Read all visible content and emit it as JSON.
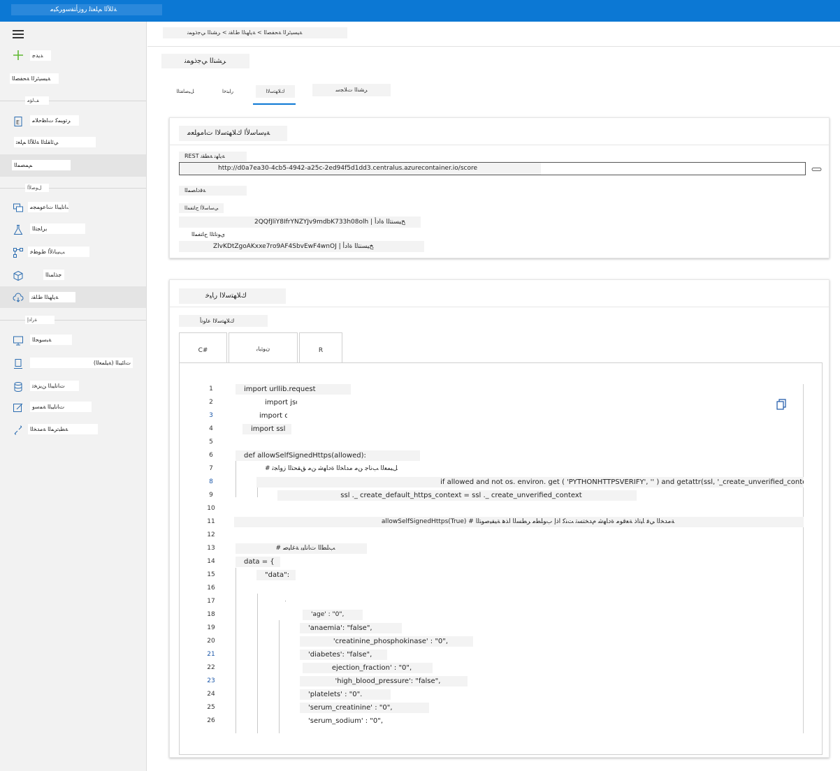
{
  "topbar": {
    "title": "ﺔﻟﻶﻟا ﻢﻠﻌﺘﻟ روزﺄﺘﻔﺳوﺮﻜﻴﻣ"
  },
  "sidebar": {
    "new_label": "ﺪﻳﺪﺟ",
    "home_label": "ﺔﻴﺴﻴﺋﺮﻟا ﺔﺤﻔﺼﻟا",
    "section_author": "ﻒﻟﺆﻣ",
    "items_author": [
      {
        "label": "ﺮﺗﻮﺒﻤﻛ تﺎﻈﺣﻼﻣ",
        "icon": "notebook-icon"
      },
      {
        "label": "ﻲﺋﺎﻘﻠﺘﻟا ﺔﻟﻶﻟا ﻢﻠﻌﺗ",
        "icon": "automl-icon"
      },
      {
        "label": "ﻢﻤﺼﻤﻟا",
        "icon": "designer-icon"
      }
    ],
    "section_assets": "لﻮﺻﻷا",
    "items_assets": [
      {
        "label": "تﺎﻧﺎﻴﺒﻟا تﺎﻋﻮﻤﺠﻣ",
        "icon": "datasets-icon"
      },
      {
        "label": "برﺎﺠﺘﻟا",
        "icon": "experiments-icon"
      },
      {
        "label": "ﺐﻴﺑﺎﻧﻷا طﻮﻄﺧ",
        "icon": "pipelines-icon"
      },
      {
        "label": "جذﺎﻤﻨﻟا",
        "icon": "models-icon"
      },
      {
        "label": "ﺔﻳﺎﻬﻨﻟا طﺎﻘﻧ",
        "icon": "endpoints-icon"
      }
    ],
    "section_manage": "ةرادإ",
    "items_manage": [
      {
        "label": "ﺔﺒﺳﻮﺤﻟا",
        "icon": "compute-icon"
      },
      {
        "label": "(ﺔﻴﻠﻤﻌﻟا) تﺎﺌﻴﺒﻟا",
        "icon": "environments-icon"
      },
      {
        "label": "تﺎﻧﺎﻴﺒﻟا ﻦﻳﺰﺨﺗ",
        "icon": "datastores-icon"
      },
      {
        "label": "تﺎﻧﺎﻴﺒﻟا ﺔﻤﺳو",
        "icon": "labeling-icon"
      },
      {
        "label": "ﺔﻄﺒﺗﺮﻤﻟا ﺔﻣﺪﺨﻟا",
        "icon": "linked-services-icon"
      }
    ]
  },
  "breadcrumb": "ﺔﻴﺴﻴﺋﺮﻟا ﺔﺤﻔﺼﻟا > ﺔﻳﺎﻬﻨﻟا طﺎﻘﻧ > ﺮﺸﻨﻟا ﻲﺟذﻮﻤﻧ",
  "page_title": "ﺮﺸﻨﻟا ﻲﺟذﻮﻤﻧ",
  "tabs": [
    {
      "label": "ﻞﻴﺻﺎﻔﺘﻟا"
    },
    {
      "label": "رﺎﺒﺘﺧا"
    },
    {
      "label": "كﻼﻬﺘﺳﻻا"
    },
    {
      "label": "ﺮﺸﻨﻟا تﻼﺠﺳ"
    }
  ],
  "basic_info": {
    "title": "ﺔﻴﺳﺎﺳﻷا كﻼﻬﺘﺳﻻا تﺎﻣﻮﻠﻌﻣ",
    "rest_label": "REST ﺔﻳﺎﻬﻧ ﺔﻄﻘﻧ",
    "url": "http://d0a7ea30-4cb5-4942-a25c-2ed94f5d1dd3.centralus.azurecontainer.io/score",
    "auth_label": "ﺔﻗدﺎﺼﻤﻟا",
    "primary_key_label": "ﻲﺳﺎﺳﻷا حﺎﺘﻔﻤﻟا",
    "primary_key": "2QQfJliY8IfrYNZYJv9mdbK733h08olh | ﺦﻴﺴﻨﺘﻟا ةادأ",
    "secondary_key_label": "يﻮﻧﺎﺜﻟا حﺎﺘﻔﻤﻟا",
    "secondary_key": "ZlvKDtZgoAKxxe7ro9AF4SbvEwF4wnOJ | ﺦﻴﺴﻨﺘﻟا ةادأ"
  },
  "consume_options": {
    "title": "كﻼﻬﺘﺳﻻا رﺎﻴﺧ",
    "type_label": "كﻼﻬﺘﺳﻻا عاﻮﻧأ",
    "languages": [
      {
        "label": "C#"
      },
      {
        "label": "نﻮﺜﻳﺎﺑ"
      },
      {
        "label": "R"
      }
    ]
  },
  "code_lines": [
    {
      "n": "1",
      "text": "import urllib.request"
    },
    {
      "n": "2",
      "text": "import json"
    },
    {
      "n": "3",
      "text": "import os"
    },
    {
      "n": "4",
      "text": "import ssl"
    },
    {
      "n": "5",
      "text": ""
    },
    {
      "n": "6",
      "text": "def allowSelfSignedHttps(allowed):"
    },
    {
      "n": "7",
      "text": "# ﻞﻴﻤﻌﻟا ﺐﻧﺎﺟ ﻦﻣ مدﺎﺨﻟا ةدﺎﻬﺷ ﻦﻣ ﻖﻘﺤﺘﻟا زوﺎﺠﺗ"
    },
    {
      "n": "8",
      "text": "if allowed and not os. environ. get ( 'PYTHONHTTPSVERIFY', '' ) and getattr(ssl, '_create_unverified_context"
    },
    {
      "n": "9",
      "text": "ssl ._ create_default_https_context = ssl ._ create_unverified_context"
    },
    {
      "n": "10",
      "text": ""
    },
    {
      "n": "11",
      "text": "allowSelfSignedHttps(True) # ﺔﻣﺪﺨﻟا ﻲﻓ ﺎﻴﺗاذ ﺔﻌﻗﻮﻣ ةدﺎﻬﺷ مﺪﺨﺘﺴﺗ ﺖﻨﻛ اذإ بﻮﻠﻄﻣ ﺮﻄﺴﻟا اﺬﻫ ﺔﻴﻔﻴﺻﻮﺘﻟا"
    },
    {
      "n": "12",
      "text": ""
    },
    {
      "n": "13",
      "text": "# ﺐﻠﻄﻟا تﺎﻧﺎﻴﺑ ﺔﻏﺎﻴﺻ"
    },
    {
      "n": "14",
      "text": "data = {"
    },
    {
      "n": "15",
      "text": "\"data\":"
    },
    {
      "n": "16",
      "text": "["
    },
    {
      "n": "17",
      "text": "{"
    },
    {
      "n": "18",
      "text": "'age' : \"0\","
    },
    {
      "n": "19",
      "text": "'anaemia': \"false\","
    },
    {
      "n": "20",
      "text": "'creatinine_phosphokinase' : \"0\","
    },
    {
      "n": "21",
      "text": "'diabetes': \"false\","
    },
    {
      "n": "22",
      "text": "ejection_fraction' : \"0\","
    },
    {
      "n": "23",
      "text": "'high_blood_pressure': \"false\","
    },
    {
      "n": "24",
      "text": "'platelets' : \"0\"."
    },
    {
      "n": "25",
      "text": "'serum_creatinine' : \"0\","
    },
    {
      "n": "26",
      "text": "'serum_sodium' : \"0\","
    }
  ],
  "colors": {
    "accent": "#0c78d4",
    "new_plus": "#5fb832",
    "line_number_blue": "#1a56a8"
  }
}
